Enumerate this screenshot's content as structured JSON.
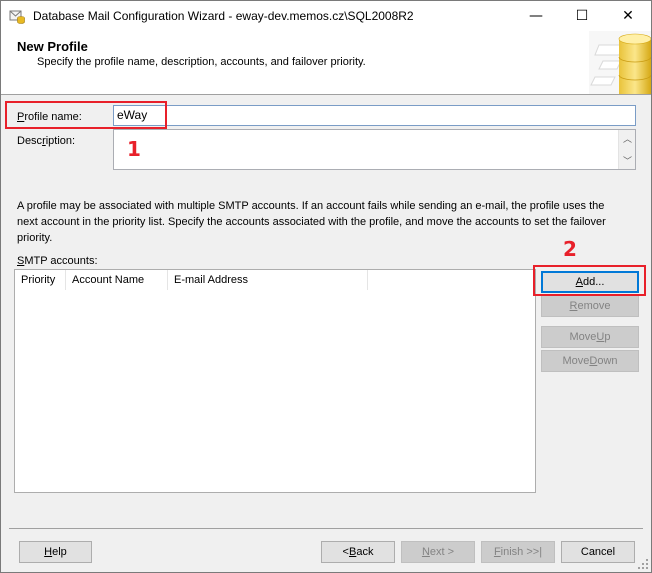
{
  "window": {
    "title": "Database Mail Configuration Wizard - eway-dev.memos.cz\\SQL2008R2",
    "controls": {
      "minimize": "—",
      "maximize": "☐",
      "close": "✕"
    }
  },
  "header": {
    "title": "New Profile",
    "subtitle": "Specify the profile name, description, accounts, and failover priority."
  },
  "form": {
    "profile_name_label_u": "P",
    "profile_name_label_rest": "rofile name:",
    "profile_name_value": "eWay",
    "description_label_pre": "Desc",
    "description_label_u": "r",
    "description_label_rest": "iption:",
    "description_value": ""
  },
  "info": {
    "text": "A profile may be associated with multiple SMTP accounts. If an account fails while sending an e-mail, the profile uses the next account in the priority list. Specify the accounts associated with the profile, and move the accounts to set the failover priority."
  },
  "smtp": {
    "label_u": "S",
    "label_rest": "MTP accounts:",
    "columns": [
      "Priority",
      "Account Name",
      "E-mail Address"
    ],
    "rows": []
  },
  "side_buttons": {
    "add_u": "A",
    "add_rest": "dd...",
    "remove_u": "R",
    "remove_rest": "emove",
    "move_up_pre": "Move ",
    "move_up_u": "U",
    "move_up_rest": "p",
    "move_down_pre": "Move ",
    "move_down_u": "D",
    "move_down_rest": "own"
  },
  "footer": {
    "help_u": "H",
    "help_rest": "elp",
    "back_pre": "< ",
    "back_u": "B",
    "back_rest": "ack",
    "next_pre": "",
    "next_u": "N",
    "next_rest": "ext >",
    "finish_pre": "",
    "finish_u": "F",
    "finish_rest": "inish >>|",
    "cancel": "Cancel"
  },
  "annotations": {
    "marker1": "1",
    "marker2": "2"
  },
  "colors": {
    "annotation_red": "#e8202a",
    "focus_blue": "#0078d7"
  }
}
